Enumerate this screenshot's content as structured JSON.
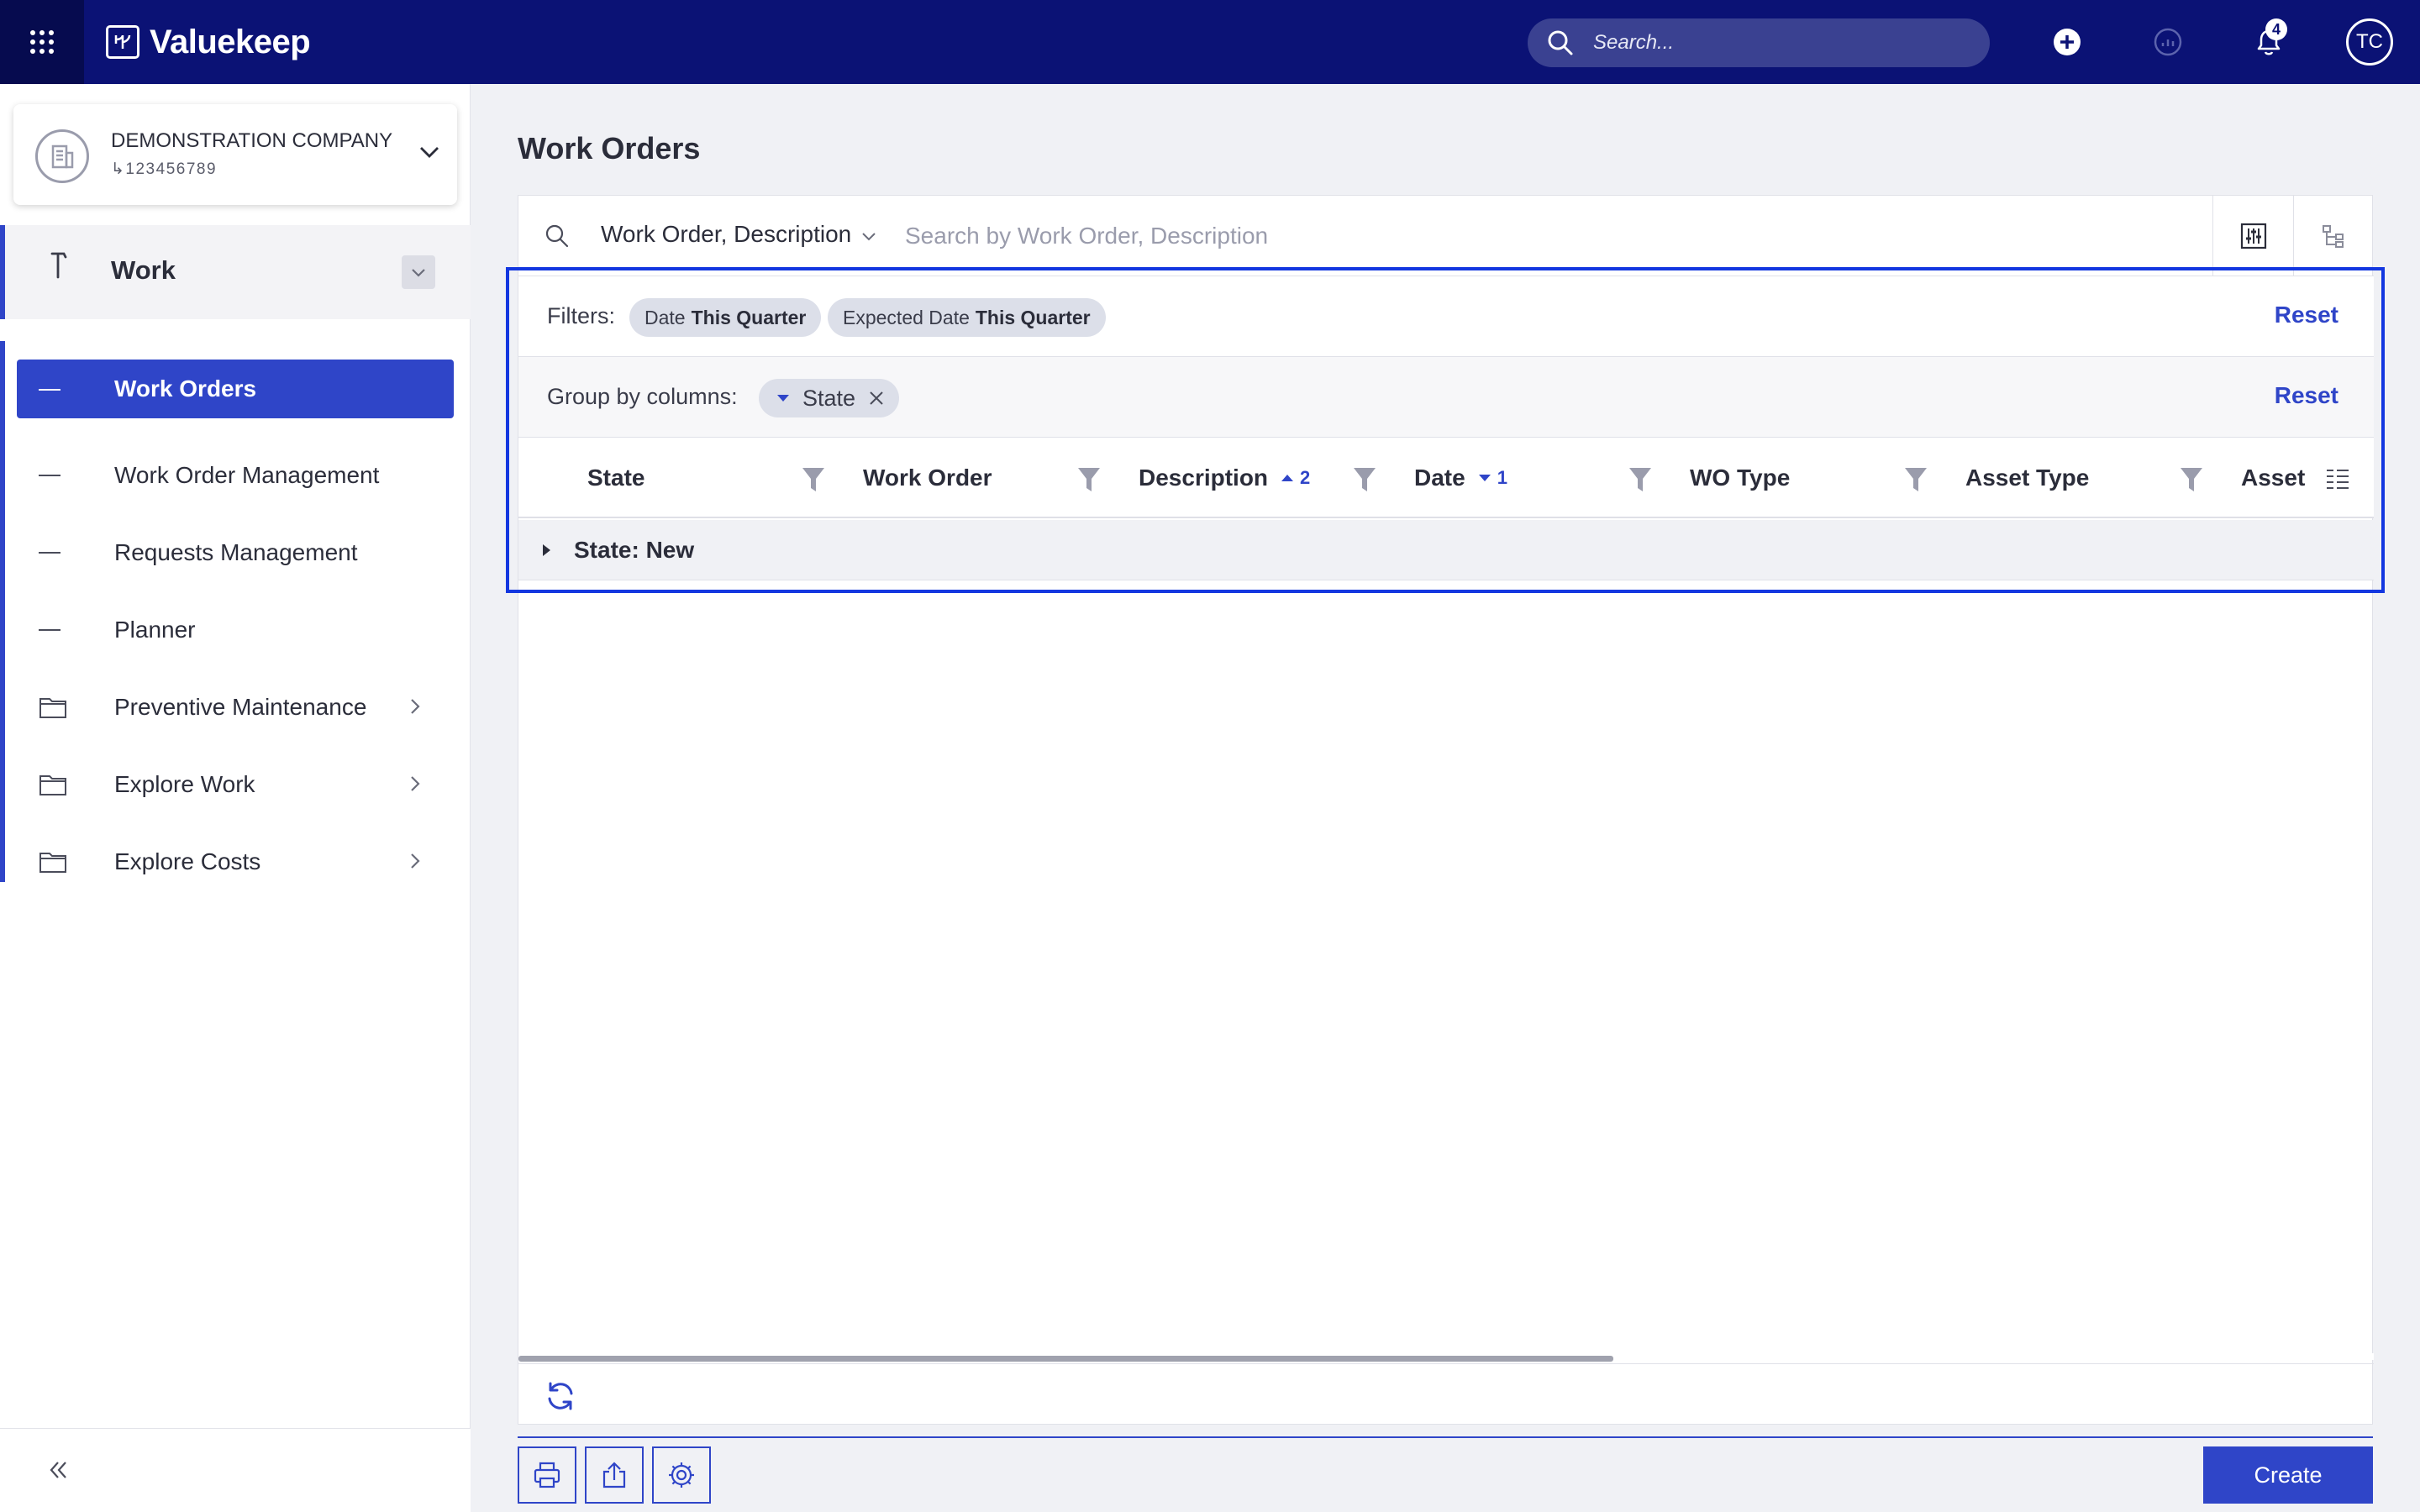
{
  "app": {
    "brand": "Valuekeep"
  },
  "topbar": {
    "search_placeholder": "Search...",
    "notifications_count": "4",
    "user_initials": "TC"
  },
  "sidebar": {
    "company": {
      "name": "DEMONSTRATION COMPANY",
      "id": "123456789"
    },
    "module": {
      "title": "Work"
    },
    "items": [
      {
        "label": "Work Orders",
        "icon": "dash-icon",
        "active": true
      },
      {
        "label": "Work Order Management",
        "icon": "dash-icon"
      },
      {
        "label": "Requests Management",
        "icon": "dash-icon"
      },
      {
        "label": "Planner",
        "icon": "dash-icon"
      },
      {
        "label": "Preventive Maintenance",
        "icon": "folder-icon",
        "has_children": true
      },
      {
        "label": "Explore Work",
        "icon": "folder-icon",
        "has_children": true
      },
      {
        "label": "Explore Costs",
        "icon": "folder-icon",
        "has_children": true
      }
    ]
  },
  "main": {
    "page_title": "Work Orders",
    "search": {
      "field_selector": "Work Order, Description",
      "placeholder": "Search by Work Order, Description"
    },
    "filters": {
      "label": "Filters:",
      "chips": [
        {
          "prefix": "Date",
          "value": "This Quarter"
        },
        {
          "prefix": "Expected Date",
          "value": "This Quarter"
        }
      ],
      "reset_label": "Reset"
    },
    "group_by": {
      "label": "Group by columns:",
      "chip_label": "State",
      "reset_label": "Reset"
    },
    "columns": [
      {
        "label": "State"
      },
      {
        "label": "Work Order"
      },
      {
        "label": "Description",
        "sort": "asc",
        "sort_order": "2"
      },
      {
        "label": "Date",
        "sort": "desc",
        "sort_order": "1"
      },
      {
        "label": "WO Type"
      },
      {
        "label": "Asset Type"
      },
      {
        "label": "Asset"
      }
    ],
    "groups": [
      {
        "label": "State: New"
      }
    ],
    "horizontal_scroll_fraction": 0.59
  },
  "footer": {
    "create_label": "Create"
  },
  "colors": {
    "topbar": "#0b1275",
    "accent": "#2f45c8",
    "highlight": "#1337e0"
  }
}
